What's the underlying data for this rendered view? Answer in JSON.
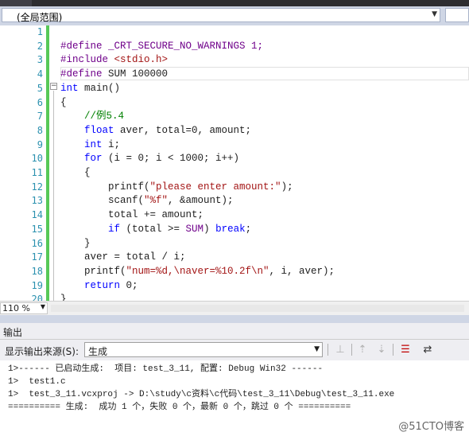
{
  "nav": {
    "scope": "(全局范围)"
  },
  "editor": {
    "line_numbers": [
      "1",
      "2",
      "3",
      "4",
      "5",
      "6",
      "7",
      "8",
      "9",
      "10",
      "11",
      "12",
      "13",
      "14",
      "15",
      "16",
      "17",
      "18",
      "19",
      "20"
    ],
    "lines": [
      [],
      [
        {
          "t": "#define",
          "c": "pp"
        },
        {
          "t": " _CRT_SECURE_NO_WARNINGS 1;",
          "c": "pp"
        }
      ],
      [
        {
          "t": "#include",
          "c": "pp"
        },
        {
          "t": " ",
          "c": ""
        },
        {
          "t": "<stdio.h>",
          "c": "st"
        }
      ],
      [
        {
          "t": "#define",
          "c": "pp"
        },
        {
          "t": " SUM 100000",
          "c": ""
        }
      ],
      [
        {
          "t": "int",
          "c": "kw"
        },
        {
          "t": " main()",
          "c": ""
        }
      ],
      [
        {
          "t": "{",
          "c": ""
        }
      ],
      [
        {
          "t": "    ",
          "c": ""
        },
        {
          "t": "//例5.4",
          "c": "cm"
        }
      ],
      [
        {
          "t": "    ",
          "c": ""
        },
        {
          "t": "float",
          "c": "kw"
        },
        {
          "t": " aver, total=0, amount;",
          "c": ""
        }
      ],
      [
        {
          "t": "    ",
          "c": ""
        },
        {
          "t": "int",
          "c": "kw"
        },
        {
          "t": " i;",
          "c": ""
        }
      ],
      [
        {
          "t": "    ",
          "c": ""
        },
        {
          "t": "for",
          "c": "kw"
        },
        {
          "t": " (i = 0; i < 1000; i++)",
          "c": ""
        }
      ],
      [
        {
          "t": "    {",
          "c": ""
        }
      ],
      [
        {
          "t": "        printf(",
          "c": ""
        },
        {
          "t": "\"please enter amount:\"",
          "c": "st"
        },
        {
          "t": ");",
          "c": ""
        }
      ],
      [
        {
          "t": "        scanf(",
          "c": ""
        },
        {
          "t": "\"%f\"",
          "c": "st"
        },
        {
          "t": ", &amount);",
          "c": ""
        }
      ],
      [
        {
          "t": "        total += amount;",
          "c": ""
        }
      ],
      [
        {
          "t": "        ",
          "c": ""
        },
        {
          "t": "if",
          "c": "kw"
        },
        {
          "t": " (total >= ",
          "c": ""
        },
        {
          "t": "SUM",
          "c": "pp"
        },
        {
          "t": ") ",
          "c": ""
        },
        {
          "t": "break",
          "c": "kw"
        },
        {
          "t": ";",
          "c": ""
        }
      ],
      [
        {
          "t": "    }",
          "c": ""
        }
      ],
      [
        {
          "t": "    aver = total / i;",
          "c": ""
        }
      ],
      [
        {
          "t": "    printf(",
          "c": ""
        },
        {
          "t": "\"num=%d,\\naver=%10.2f\\n\"",
          "c": "st"
        },
        {
          "t": ", i, aver);",
          "c": ""
        }
      ],
      [
        {
          "t": "    ",
          "c": ""
        },
        {
          "t": "return",
          "c": "kw"
        },
        {
          "t": " 0;",
          "c": ""
        }
      ],
      [
        {
          "t": "}",
          "c": ""
        }
      ]
    ],
    "zoom": "110 %"
  },
  "output": {
    "title": "输出",
    "source_label": "显示输出来源(S):",
    "source_value": "生成",
    "lines": [
      "1>------ 已启动生成:  项目: test_3_11, 配置: Debug Win32 ------",
      "1>  test1.c",
      "1>  test_3_11.vcxproj -> D:\\study\\c资料\\c代码\\test_3_11\\Debug\\test_3_11.exe",
      "========== 生成:  成功 1 个，失败 0 个，最新 0 个，跳过 0 个 =========="
    ]
  },
  "watermark": "@51CTO博客"
}
